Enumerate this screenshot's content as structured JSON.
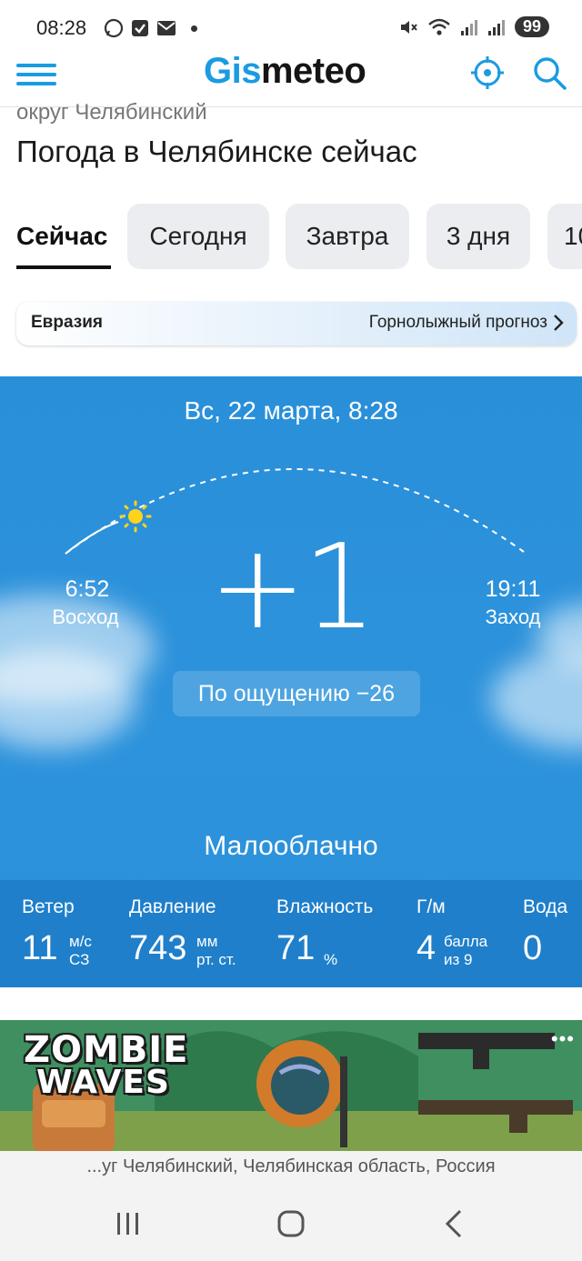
{
  "status_bar": {
    "time": "08:28",
    "battery": "99",
    "left_icons": [
      "whatsapp-icon",
      "check-message-icon",
      "mail-icon",
      "dot-icon"
    ],
    "right_icons": [
      "mute-icon",
      "wifi-icon",
      "signal-icon",
      "signal-icon"
    ]
  },
  "header": {
    "logo_part1": "Gis",
    "logo_part2": "meteo",
    "logo_color": "#1a9be2"
  },
  "breadcrumb": "округ Челябинский",
  "page_title": "Погода в Челябинске сейчас",
  "tabs": [
    {
      "label": "Сейчас",
      "active": true
    },
    {
      "label": "Сегодня",
      "active": false
    },
    {
      "label": "Завтра",
      "active": false
    },
    {
      "label": "3 дня",
      "active": false
    },
    {
      "label": "10",
      "active": false
    }
  ],
  "banner": {
    "left": "Евразия",
    "right": "Горнолыжный прогноз"
  },
  "weather": {
    "date": "Вс, 22 марта, 8:28",
    "sunrise_time": "6:52",
    "sunrise_label": "Восход",
    "sunset_time": "19:11",
    "sunset_label": "Заход",
    "temperature": "+1",
    "feels_like": "По ощущению −26",
    "condition": "Малооблачно",
    "card_color": "#2b90da",
    "stats": {
      "wind_label": "Ветер",
      "wind_value": "11",
      "wind_unit": "м/с",
      "wind_dir": "СЗ",
      "pressure_label": "Давление",
      "pressure_value": "743",
      "pressure_unit": "мм",
      "pressure_unit2": "рт. ст.",
      "humidity_label": "Влажность",
      "humidity_value": "71",
      "humidity_unit": "%",
      "geomag_label": "Г/м",
      "geomag_value": "4",
      "geomag_unit": "балла",
      "geomag_unit2": "из 9",
      "water_label": "Вода",
      "water_value": "0"
    }
  },
  "ad": {
    "title_line1": "ZOMBIE",
    "title_line2": "WAVES",
    "more": "•••"
  },
  "location_strip": "...уг Челябинский, Челябинская область, Россия",
  "navbar": {
    "buttons": [
      "recent-apps-icon",
      "home-icon",
      "back-icon"
    ]
  }
}
